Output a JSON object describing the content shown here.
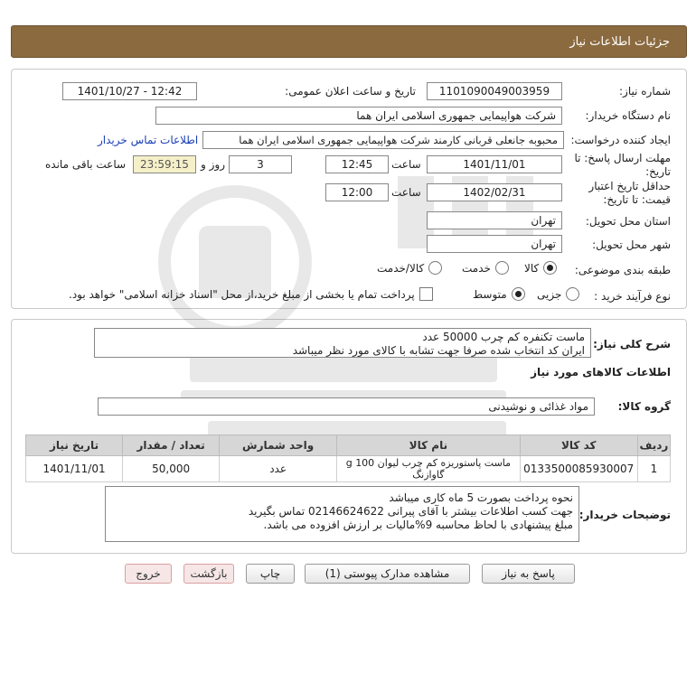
{
  "header": {
    "title": "جزئیات اطلاعات نیاز"
  },
  "form": {
    "need_number_label": "شماره نیاز:",
    "need_number": "1101090049003959",
    "announce_label": "تاریخ و ساعت اعلان عمومی:",
    "announce_value": "1401/10/27 - 12:42",
    "buyer_org_label": "نام دستگاه خریدار:",
    "buyer_org": "شرکت هواپیمایی جمهوری اسلامی ایران هما",
    "requester_label": "ایجاد کننده درخواست:",
    "requester": "محبوبه جانعلی قربانی کارمند شرکت هواپیمایی جمهوری اسلامی ایران هما",
    "contact_link": "اطلاعات تماس خریدار",
    "deadline_label_1": "مهلت ارسال پاسخ: تا",
    "deadline_label_2": "تاریخ:",
    "deadline_date": "1401/11/01",
    "time_label": "ساعت",
    "deadline_time": "12:45",
    "days_value": "3",
    "days_label": "روز و",
    "remaining_time": "23:59:15",
    "remaining_label": "ساعت باقی مانده",
    "validity_label_1": "حداقل تاریخ اعتبار",
    "validity_label_2": "قیمت: تا تاریخ:",
    "validity_date": "1402/02/31",
    "validity_time": "12:00",
    "province_label": "استان محل تحویل:",
    "province": "تهران",
    "city_label": "شهر محل تحویل:",
    "city": "تهران",
    "category_label": "طبقه بندی موضوعی:",
    "category_options": [
      "کالا",
      "خدمت",
      "کالا/خدمت"
    ],
    "process_label": "نوع فرآیند خرید :",
    "process_options": [
      "جزیی",
      "متوسط"
    ],
    "payment_note": "پرداخت تمام یا بخشی از مبلغ خرید،از محل \"اسناد خزانه اسلامی\" خواهد بود."
  },
  "details": {
    "summary_label": "شرح کلی نیاز:",
    "summary_line1": "ماست تکنفره کم چرب     50000 عدد",
    "summary_line2": "ایران کد انتخاب شده صرفا جهت تشابه با کالای مورد نظر میباشد",
    "goods_info_title": "اطلاعات کالاهای مورد نیاز",
    "group_label": "گروه کالا:",
    "group_value": "مواد غذائی و نوشیدنی",
    "table": {
      "headers": [
        "ردیف",
        "کد کالا",
        "نام کالا",
        "واحد شمارش",
        "تعداد / مقدار",
        "تاریخ نیاز"
      ],
      "rows": [
        [
          "1",
          "0133500085930007",
          "ماست پاستوریزه کم چرب لیوان 100 g گاوازنگ",
          "عدد",
          "50,000",
          "1401/11/01"
        ]
      ]
    },
    "buyer_notes_label": "توضیحات خریدار:",
    "buyer_notes_line1": "نحوه پرداخت بصورت 5 ماه کاری میباشد",
    "buyer_notes_line2": "جهت کسب اطلاعات بیشتر با آقای پیرانی 02146624622 تماس بگیرید",
    "buyer_notes_line3": "مبلغ پیشنهادی با لحاظ محاسبه 9%مالیات بر ارزش افزوده می باشد."
  },
  "buttons": {
    "reply": "پاسخ به نیاز",
    "attachments": "مشاهده مدارک پیوستی (1)",
    "print": "چاپ",
    "back": "بازگشت",
    "exit": "خروج"
  }
}
